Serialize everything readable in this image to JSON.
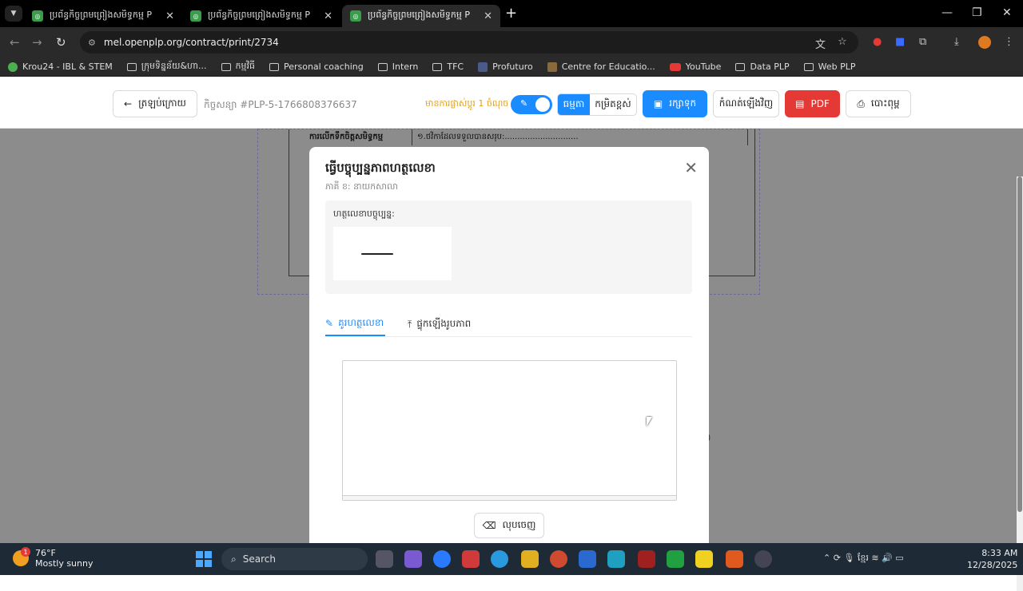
{
  "browser": {
    "tabs": [
      {
        "title": "ប្រព័ន្ធកិច្ចព្រមព្រៀងសមិទ្ធកម្ម P",
        "active": false
      },
      {
        "title": "ប្រព័ន្ធកិច្ចព្រមព្រៀងសមិទ្ធកម្ម P",
        "active": false
      },
      {
        "title": "ប្រព័ន្ធកិច្ចព្រមព្រៀងសមិទ្ធកម្ម P",
        "active": true
      }
    ],
    "url": "mel.openplp.org/contract/print/2734",
    "bookmarks": [
      {
        "label": "Krou24 - IBL & STEM",
        "icon": "site-icon"
      },
      {
        "label": "ក្រុមទិន្នន័យ&ហា...",
        "icon": "folder-icon"
      },
      {
        "label": "កម្មវិធី",
        "icon": "folder-icon"
      },
      {
        "label": "Personal coaching",
        "icon": "folder-icon"
      },
      {
        "label": "Intern",
        "icon": "folder-icon"
      },
      {
        "label": "TFC",
        "icon": "folder-icon"
      },
      {
        "label": "Profuturo",
        "icon": "site-icon"
      },
      {
        "label": "Centre for Educatio...",
        "icon": "site-icon"
      },
      {
        "label": "YouTube",
        "icon": "youtube-icon"
      },
      {
        "label": "Data PLP",
        "icon": "folder-icon"
      },
      {
        "label": "Web PLP",
        "icon": "folder-icon"
      }
    ]
  },
  "toolbar": {
    "back_label": "ត្រឡប់ក្រោយ",
    "contract_no": "កិច្ចសន្យា #PLP-5-1766808376637",
    "reminder": "មានការផ្លាស់ប្តូរ 1 ចំណុច",
    "seg_normal": "ធម្មតា",
    "seg_advanced": "កម្រិតខ្ពស់",
    "save_label": "រក្សាទុក",
    "reset_label": "កំណត់ឡើងវិញ",
    "pdf_label": "PDF",
    "print_label": "បោះពុម្ព"
  },
  "document": {
    "row_label": "ការលើកទឹកចិត្តសមិទ្ធកម្ម",
    "row_value": "១.ថវិកាដែលទទួលបានសរុប:............................."
  },
  "modal": {
    "title": "ធ្វើបច្ចុប្បន្នភាពហត្ថលេខា",
    "subtitle": "ភាគី ខ: នាយកសាលា",
    "current_label": "ហត្ថលេខាបច្ចុប្បន្ន:",
    "tab_draw": "គូរហត្ថលេខា",
    "tab_upload": "ផ្ទុកឡើងរូបភាព",
    "clear_label": "លុបចេញ"
  },
  "taskbar": {
    "temperature": "76°F",
    "weather": "Mostly sunny",
    "weather_badge": "1",
    "search_label": "Search",
    "time": "8:33 AM",
    "date": "12/28/2025"
  }
}
